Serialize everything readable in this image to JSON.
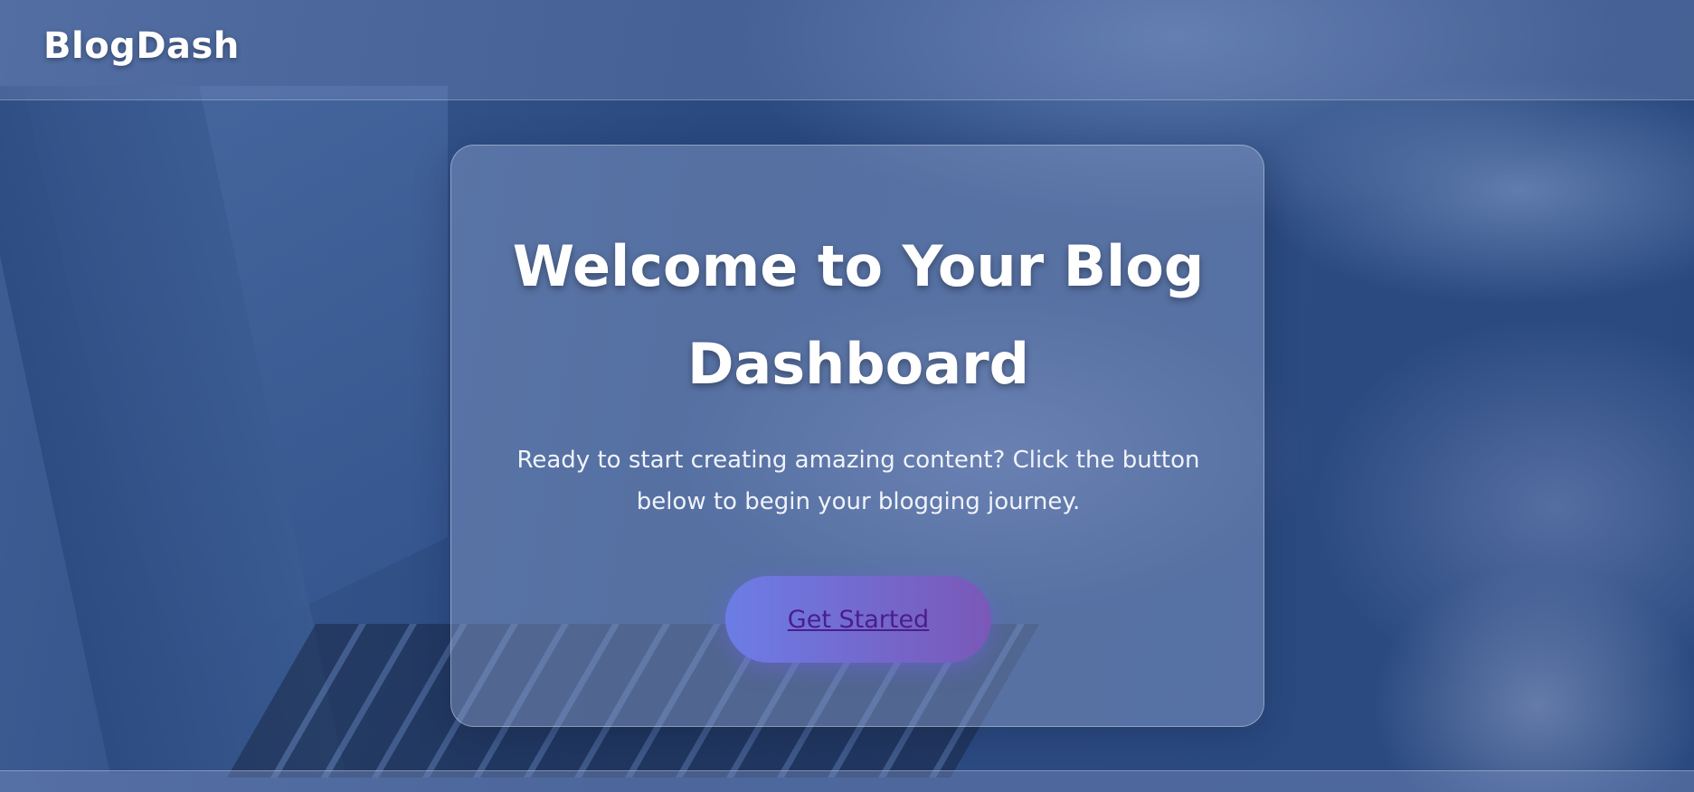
{
  "header": {
    "brand": "BlogDash"
  },
  "hero": {
    "title_line1": "Welcome to Your Blog",
    "title_line2": "Dashboard",
    "subtitle_line1": "Ready to start creating amazing content? Click the button",
    "subtitle_line2": "below to begin your blogging journey.",
    "cta_label": "Get Started"
  },
  "colors": {
    "cta_gradient_start": "#6c7de6",
    "cta_gradient_end": "#7a58b8",
    "cta_text": "#4b1d8e",
    "text": "#ffffff"
  }
}
